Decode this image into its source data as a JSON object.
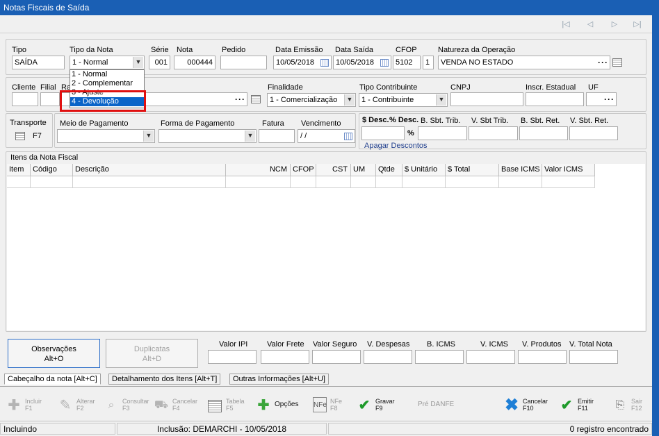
{
  "window": {
    "title": "Notas Fiscais de Saída"
  },
  "header": {
    "tipo": {
      "label": "Tipo",
      "value": "SAÍDA"
    },
    "tipo_nota": {
      "label": "Tipo da Nota",
      "value": "1 - Normal",
      "options": [
        "1 - Normal",
        "2 - Complementar",
        "3 - Ajuste",
        "4 - Devolução"
      ],
      "highlighted": "4 - Devolução"
    },
    "serie": {
      "label": "Série",
      "value": "001"
    },
    "nota": {
      "label": "Nota",
      "value": "000444"
    },
    "pedido": {
      "label": "Pedido",
      "value": ""
    },
    "data_emissao": {
      "label": "Data Emissão",
      "value": "10/05/2018"
    },
    "data_saida": {
      "label": "Data Saída",
      "value": "10/05/2018"
    },
    "cfop": {
      "label": "CFOP",
      "value": "5102",
      "seq": "1"
    },
    "natureza": {
      "label": "Natureza da Operação",
      "value": "VENDA NO ESTADO"
    }
  },
  "row2": {
    "cliente": {
      "label": "Cliente",
      "value": ""
    },
    "filial": {
      "label": "Filial",
      "value": ""
    },
    "razao": {
      "label": "Ra",
      "value": ""
    },
    "finalidade": {
      "label": "Finalidade",
      "value": "1 - Comercialização"
    },
    "tipo_contribuinte": {
      "label": "Tipo Contribuinte",
      "value": "1 - Contribuinte"
    },
    "cnpj": {
      "label": "CNPJ",
      "value": ""
    },
    "inscr_estadual": {
      "label": "Inscr. Estadual",
      "value": ""
    },
    "uf": {
      "label": "UF",
      "value": ""
    }
  },
  "row3": {
    "transporte": {
      "label": "Transporte",
      "key": "F7"
    },
    "meio_pagamento": {
      "label": "Meio de Pagamento",
      "value": ""
    },
    "forma_pagamento": {
      "label": "Forma de Pagamento",
      "value": ""
    },
    "fatura": {
      "label": "Fatura",
      "value": ""
    },
    "vencimento": {
      "label": "Vencimento",
      "value": " /  /"
    },
    "desconto": {
      "label_valor": "$ Desc.",
      "label_pct": "% Desc.",
      "pct_sign": "%",
      "apagar": "Apagar Descontos"
    },
    "b_sbt_trib": {
      "label": "B. Sbt. Trib.",
      "value": ""
    },
    "v_sbt_trib": {
      "label": "V. Sbt Trib.",
      "value": ""
    },
    "b_sbt_ret": {
      "label": "B. Sbt. Ret.",
      "value": ""
    },
    "v_sbt_ret": {
      "label": "V. Sbt. Ret.",
      "value": ""
    }
  },
  "items": {
    "title": "Itens da Nota Fiscal",
    "columns": [
      "Item",
      "Código",
      "Descrição",
      "NCM",
      "CFOP",
      "CST",
      "UM",
      "Qtde",
      "$ Unitário",
      "$ Total",
      "Base ICMS",
      "Valor ICMS"
    ]
  },
  "footer": {
    "observacoes": {
      "label": "Observações",
      "key": "Alt+O"
    },
    "duplicatas": {
      "label": "Duplicatas",
      "key": "Alt+D"
    },
    "totals": [
      {
        "label": "Valor IPI",
        "value": ""
      },
      {
        "label": "Valor Frete",
        "value": ""
      },
      {
        "label": "Valor Seguro",
        "value": ""
      },
      {
        "label": "V. Despesas",
        "value": ""
      },
      {
        "label": "B. ICMS",
        "value": ""
      },
      {
        "label": "V. ICMS",
        "value": ""
      },
      {
        "label": "V. Produtos",
        "value": ""
      },
      {
        "label": "V. Total Nota",
        "value": ""
      }
    ]
  },
  "tabs": [
    {
      "label": "Cabeçalho da nota  [Alt+C]"
    },
    {
      "label": "Detalhamento dos Itens  [Alt+T]"
    },
    {
      "label": "Outras Informações  [Alt+U]"
    }
  ],
  "toolbar": [
    {
      "label": "Incluir",
      "key": "F1",
      "icon": "plus-icon"
    },
    {
      "label": "Alterar",
      "key": "F2",
      "icon": "pencil-icon"
    },
    {
      "label": "Consultar",
      "key": "F3",
      "icon": "magnifier-icon"
    },
    {
      "label": "Cancelar",
      "key": "F4",
      "icon": "cart-icon"
    },
    {
      "label": "Tabela",
      "key": "F5",
      "icon": "table-icon"
    },
    {
      "label": "Opções",
      "key": "",
      "icon": "green-plus-icon"
    },
    {
      "label": "NFe",
      "key": "F8",
      "icon": "nfe-icon"
    },
    {
      "label": "Gravar",
      "key": "F9",
      "icon": "checkmark-icon"
    },
    {
      "label": "Pré DANFE",
      "key": "",
      "icon": ""
    },
    {
      "label": "Cancelar",
      "key": "F10",
      "icon": "x-icon"
    },
    {
      "label": "Emitir",
      "key": "F11",
      "icon": "emit-check-icon"
    },
    {
      "label": "Sair",
      "key": "F12",
      "icon": "exit-icon"
    }
  ],
  "status": {
    "mode": "Incluindo",
    "inclusao": "Inclusão: DEMARCHI - 10/05/2018",
    "registros": "0 registro encontrado"
  }
}
